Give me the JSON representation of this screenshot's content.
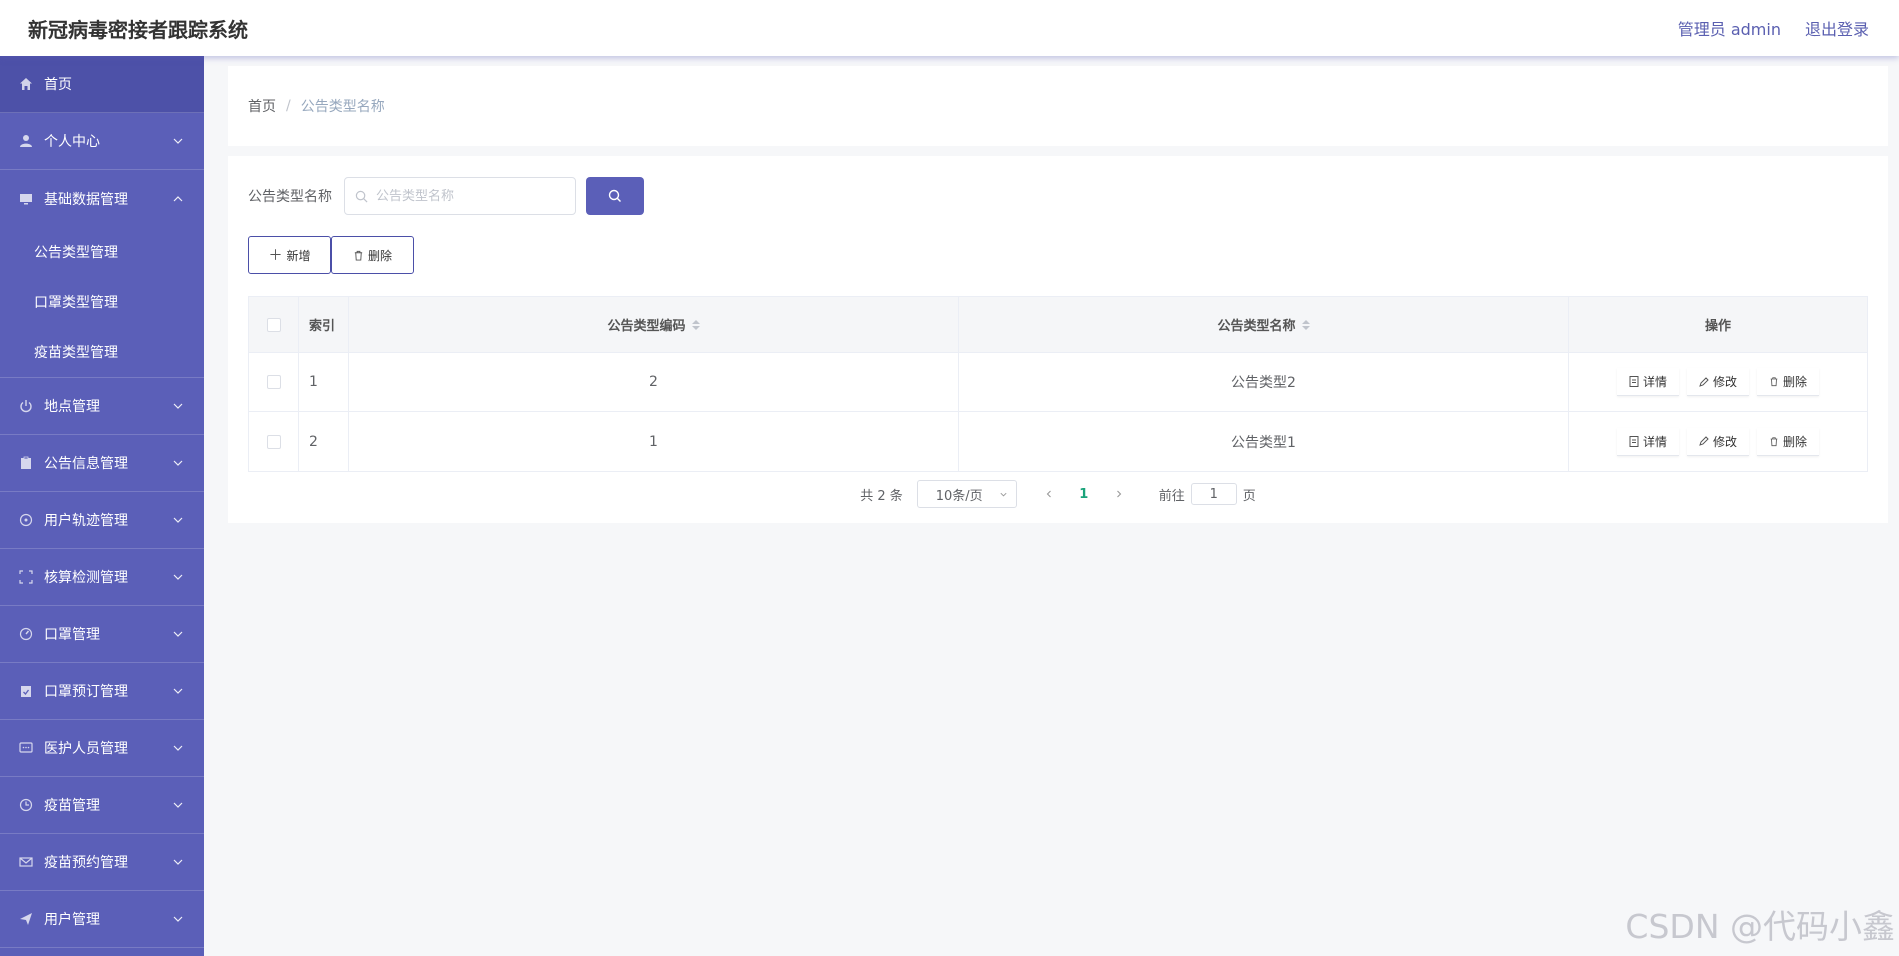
{
  "header": {
    "title": "新冠病毒密接者跟踪系统",
    "user": "管理员 admin",
    "logout": "退出登录"
  },
  "sidebar": {
    "items": [
      {
        "label": "首页"
      },
      {
        "label": "个人中心"
      },
      {
        "label": "基础数据管理"
      },
      {
        "label": "地点管理"
      },
      {
        "label": "公告信息管理"
      },
      {
        "label": "用户轨迹管理"
      },
      {
        "label": "核算检测管理"
      },
      {
        "label": "口罩管理"
      },
      {
        "label": "口罩预订管理"
      },
      {
        "label": "医护人员管理"
      },
      {
        "label": "疫苗管理"
      },
      {
        "label": "疫苗预约管理"
      },
      {
        "label": "用户管理"
      }
    ],
    "submenu": [
      {
        "label": "公告类型管理"
      },
      {
        "label": "口罩类型管理"
      },
      {
        "label": "疫苗类型管理"
      }
    ]
  },
  "breadcrumb": {
    "home": "首页",
    "sep": "/",
    "current": "公告类型名称"
  },
  "search": {
    "label": "公告类型名称",
    "placeholder": "公告类型名称"
  },
  "toolbar": {
    "add": "新增",
    "delete": "删除"
  },
  "table": {
    "headers": {
      "index": "索引",
      "code": "公告类型编码",
      "name": "公告类型名称",
      "ops": "操作"
    },
    "rows": [
      {
        "index": "1",
        "code": "2",
        "name": "公告类型2"
      },
      {
        "index": "2",
        "code": "1",
        "name": "公告类型1"
      }
    ],
    "ops": {
      "detail": "详情",
      "edit": "修改",
      "delete": "删除"
    }
  },
  "pagination": {
    "total": "共 2 条",
    "page_size": "10条/页",
    "current": "1",
    "goto_prefix": "前往",
    "goto_value": "1",
    "goto_suffix": "页"
  },
  "watermark": "CSDN @代码小鑫",
  "colors": {
    "sidebar": "#5b5fb8",
    "accent": "#5b5fb8",
    "page_active": "#1aa37a"
  }
}
